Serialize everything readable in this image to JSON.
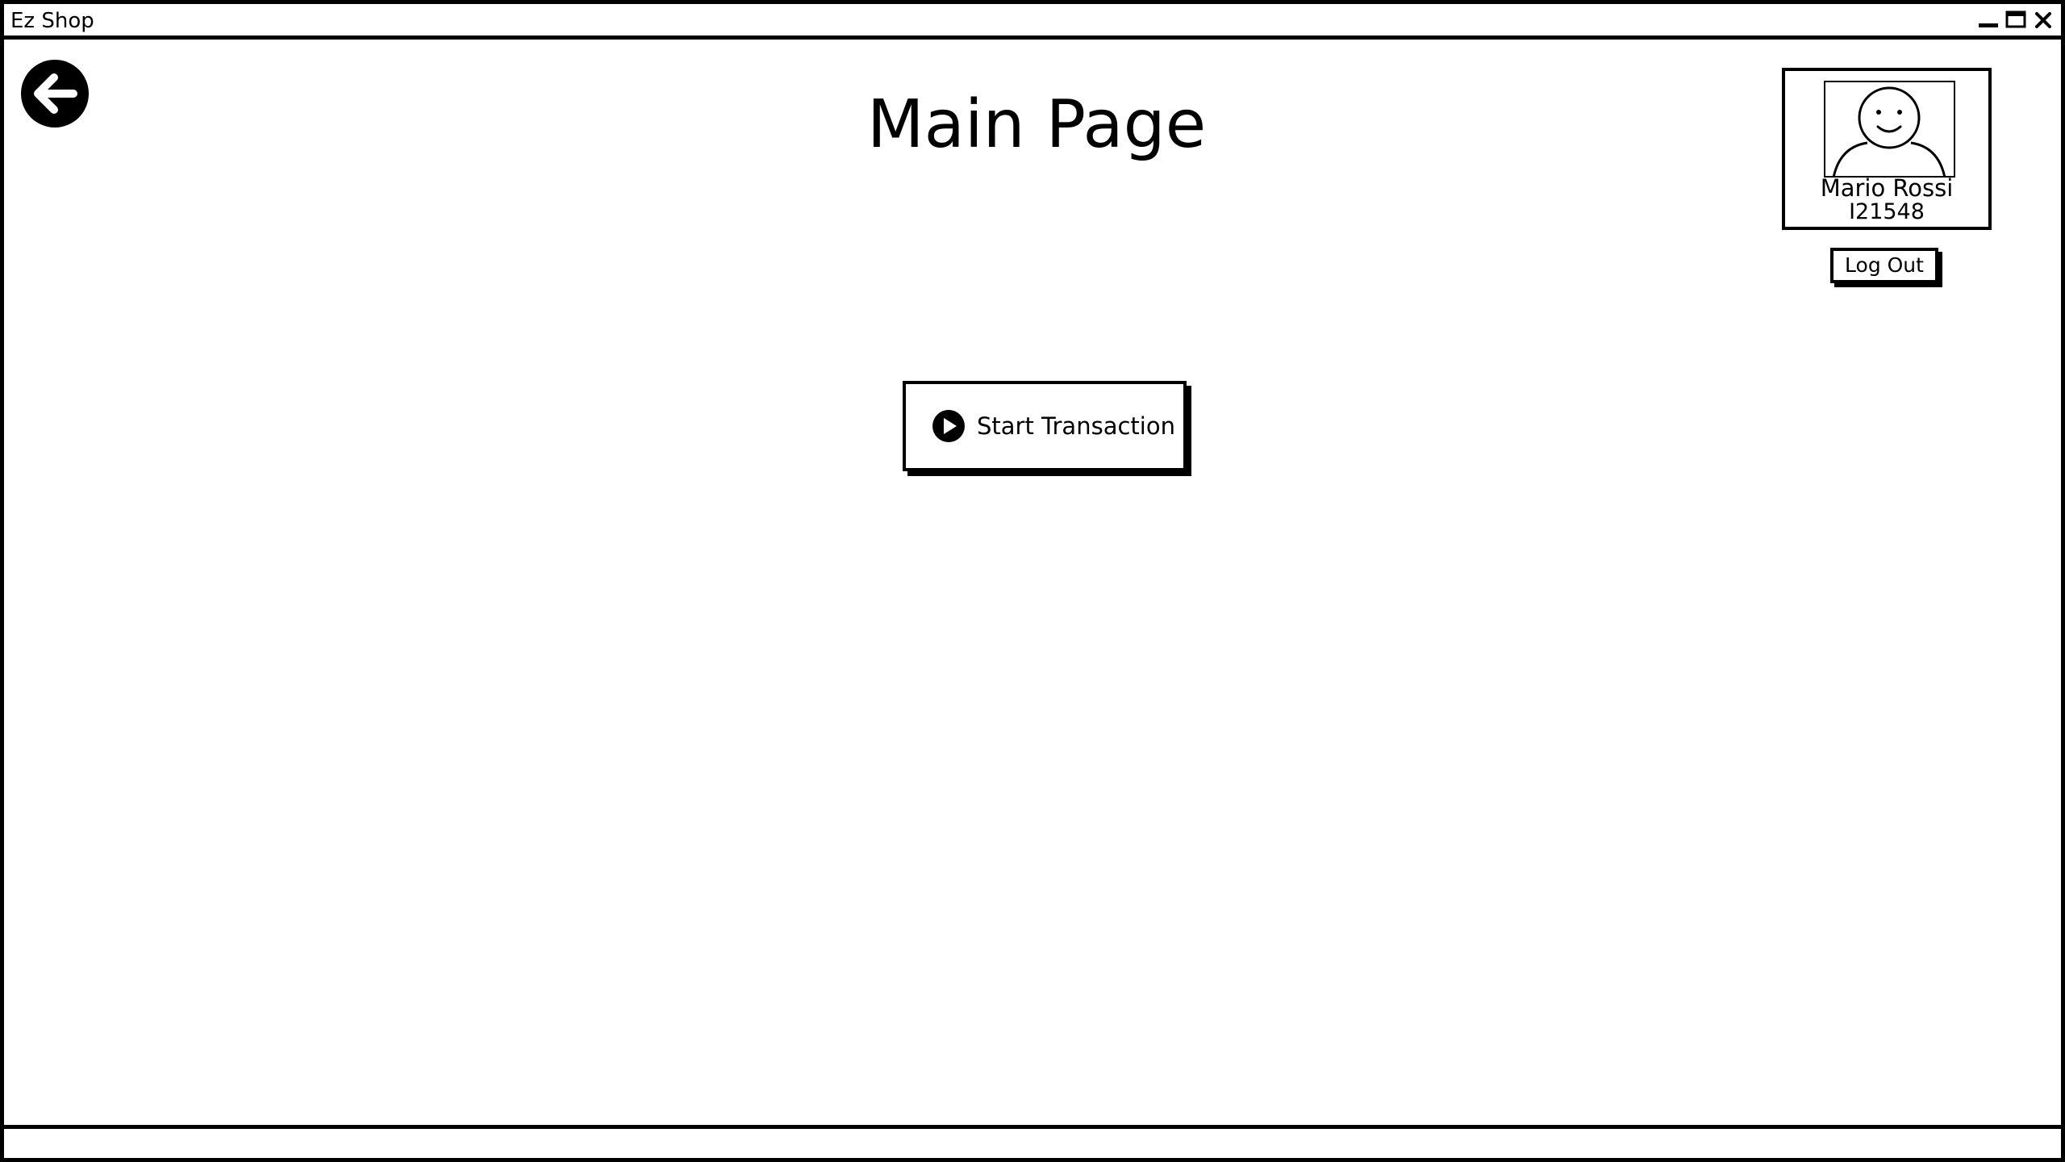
{
  "window": {
    "title": "Ez Shop",
    "controls": {
      "minimize_icon": "minimize-icon",
      "maximize_icon": "maximize-icon",
      "close_icon": "close-icon"
    }
  },
  "header": {
    "back_icon": "arrow-left-circle-icon",
    "title": "Main Page"
  },
  "user": {
    "avatar_icon": "user-avatar-icon",
    "name": "Mario Rossi",
    "id": "I21548",
    "logout_label": "Log Out"
  },
  "main": {
    "start_transaction_icon": "play-circle-icon",
    "start_transaction_label": "Start Transaction"
  },
  "colors": {
    "ink": "#000000",
    "background": "#ffffff"
  }
}
